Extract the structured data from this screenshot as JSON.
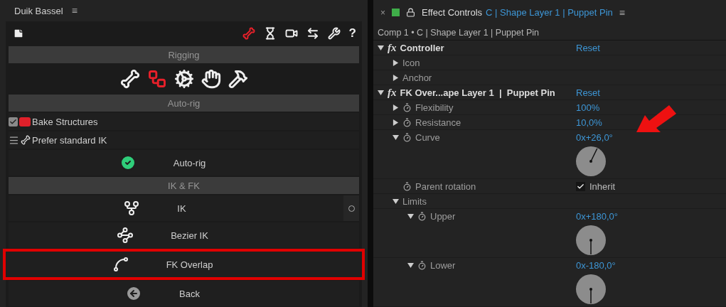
{
  "left_panel": {
    "title": "Duik Bassel",
    "menu_glyph": "≡",
    "toolbar": [
      {
        "kind": "bones",
        "selected": true
      },
      {
        "kind": "hourglass",
        "selected": false
      },
      {
        "kind": "camera",
        "selected": false
      },
      {
        "kind": "swap",
        "selected": false
      },
      {
        "kind": "wrench",
        "selected": false
      },
      {
        "kind": "help",
        "label": "?",
        "selected": false
      }
    ],
    "sections": [
      {
        "title": "Rigging",
        "tools": [
          {
            "kind": "bones",
            "selected": false
          },
          {
            "kind": "structure",
            "selected": true
          },
          {
            "kind": "gear",
            "selected": false
          },
          {
            "kind": "hand",
            "selected": false
          },
          {
            "kind": "hammer",
            "selected": false
          }
        ]
      },
      {
        "title": "Auto-rig",
        "rows": [
          {
            "kind": "checkbox",
            "label": "Bake Structures",
            "checked": true
          },
          {
            "kind": "option",
            "label": "Prefer standard IK"
          },
          {
            "kind": "action",
            "label": "Auto-rig",
            "highlighted": false
          }
        ]
      },
      {
        "title": "IK & FK",
        "rows": [
          {
            "kind": "split",
            "label": "IK",
            "highlighted": false
          },
          {
            "kind": "action",
            "label": "Bezier IK",
            "highlighted": false
          },
          {
            "kind": "action",
            "label": "FK Overlap",
            "highlighted": true
          },
          {
            "kind": "action",
            "label": "Back",
            "highlighted": false
          }
        ]
      }
    ]
  },
  "right_panel": {
    "close": "×",
    "title": "Effect Controls",
    "layer": "C | Shape Layer 1 | Puppet Pin",
    "menu_glyph": "≡",
    "breadcrumb": "Comp 1 • C | Shape Layer 1 | Puppet Pin",
    "annotation_arrow": true,
    "effects": [
      {
        "kind": "effect",
        "badge": "fx",
        "label": "Controller",
        "value": "Reset",
        "expanded": true,
        "children": [
          {
            "kind": "group",
            "label": "Icon",
            "expanded": false
          },
          {
            "kind": "group",
            "label": "Anchor",
            "expanded": false
          }
        ]
      },
      {
        "kind": "effect",
        "badge": "fx",
        "label": "FK Over...ape Layer 1  |  Puppet Pin",
        "value": "Reset",
        "expanded": true,
        "children": [
          {
            "kind": "param",
            "label": "Flexibility",
            "value": "100%",
            "expanded": false
          },
          {
            "kind": "param",
            "label": "Resistance",
            "value": "10,0%",
            "expanded": false
          },
          {
            "kind": "angle",
            "label": "Curve",
            "value": "0x+26,0°",
            "expanded": true
          },
          {
            "kind": "checkbox",
            "label": "Parent rotation",
            "value": "Inherit",
            "checked": true
          },
          {
            "kind": "group",
            "label": "Limits",
            "expanded": true,
            "children": [
              {
                "kind": "angle",
                "label": "Upper",
                "value": "0x+180,0°",
                "expanded": true
              },
              {
                "kind": "angle",
                "label": "Lower",
                "value": "0x-180,0°",
                "expanded": true
              }
            ]
          }
        ]
      }
    ]
  }
}
